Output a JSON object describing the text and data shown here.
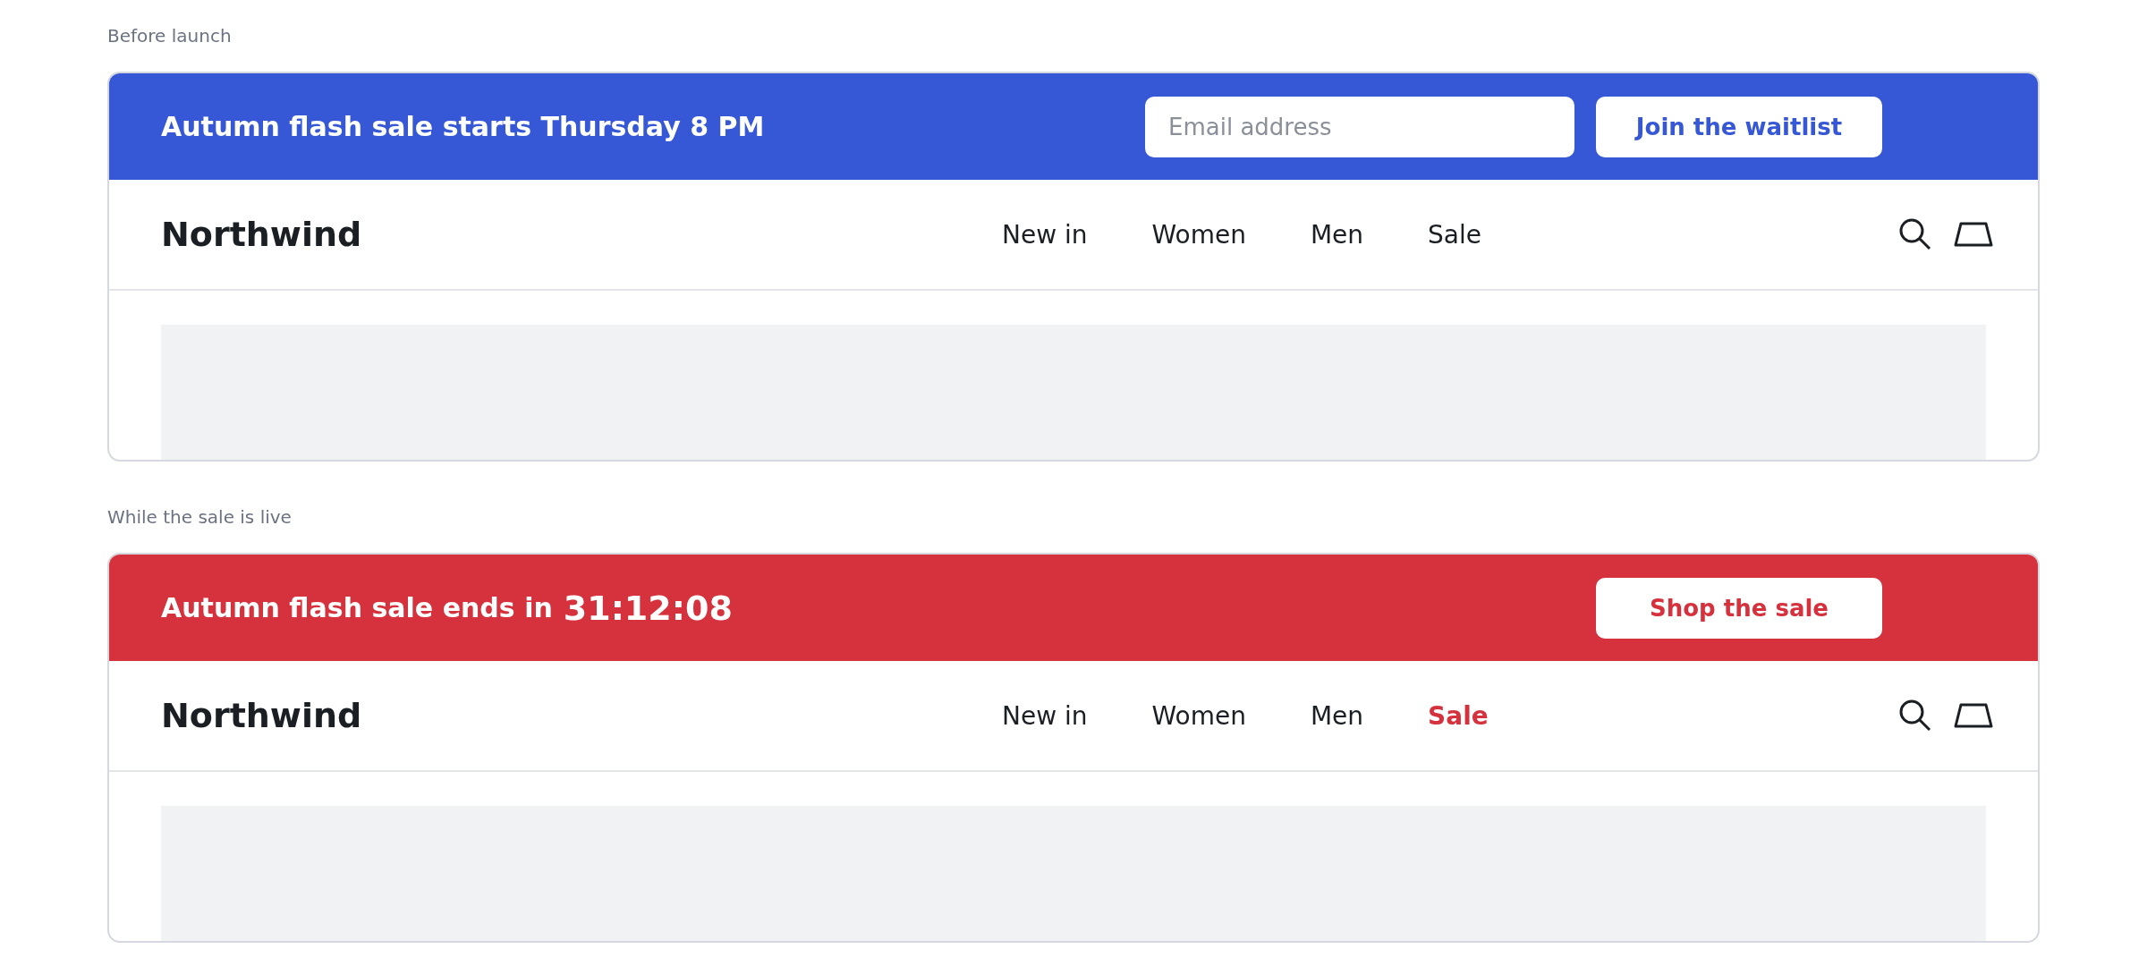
{
  "sections": [
    {
      "caption": "Before launch",
      "banner": {
        "kind": "signup",
        "text": "Autumn flash sale starts Thursday 8 PM",
        "email": {
          "placeholder": "Email address"
        },
        "button": "Join the waitlist"
      },
      "header": {
        "logo": "Northwind",
        "nav": [
          {
            "label": "New in",
            "highlighted": false
          },
          {
            "label": "Women",
            "highlighted": false
          },
          {
            "label": "Men",
            "highlighted": false
          },
          {
            "label": "Sale",
            "highlighted": false
          }
        ]
      }
    },
    {
      "caption": "While the sale is live",
      "banner": {
        "kind": "countdown",
        "text": "Autumn flash sale ends in",
        "timer": "31:12:08",
        "button": "Shop the sale"
      },
      "header": {
        "logo": "Northwind",
        "nav": [
          {
            "label": "New in",
            "highlighted": false
          },
          {
            "label": "Women",
            "highlighted": false
          },
          {
            "label": "Men",
            "highlighted": false
          },
          {
            "label": "Sale",
            "highlighted": true
          }
        ]
      }
    }
  ]
}
